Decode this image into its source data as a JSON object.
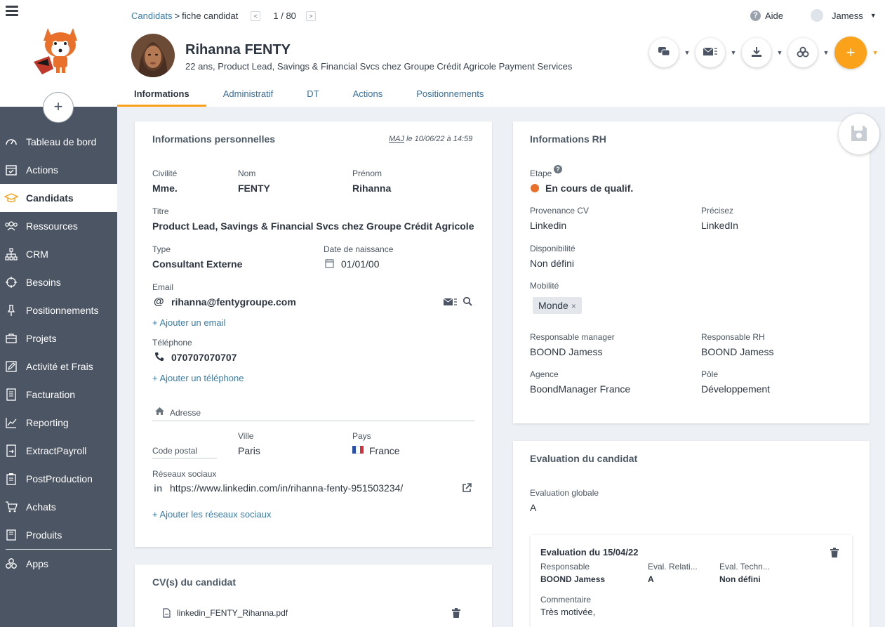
{
  "sidebar": {
    "items": [
      {
        "label": "Tableau de bord",
        "icon": "dashboard-icon"
      },
      {
        "label": "Actions",
        "icon": "calendar-check-icon"
      },
      {
        "label": "Candidats",
        "icon": "graduation-cap-icon",
        "active": true
      },
      {
        "label": "Ressources",
        "icon": "users-icon"
      },
      {
        "label": "CRM",
        "icon": "org-chart-icon"
      },
      {
        "label": "Besoins",
        "icon": "crosshair-icon"
      },
      {
        "label": "Positionnements",
        "icon": "pin-icon"
      },
      {
        "label": "Projets",
        "icon": "briefcase-icon"
      },
      {
        "label": "Activité et Frais",
        "icon": "edit-icon"
      },
      {
        "label": "Facturation",
        "icon": "invoice-icon"
      },
      {
        "label": "Reporting",
        "icon": "chart-line-icon"
      },
      {
        "label": "ExtractPayroll",
        "icon": "export-icon"
      },
      {
        "label": "PostProduction",
        "icon": "clipboard-icon"
      },
      {
        "label": "Achats",
        "icon": "cart-icon"
      },
      {
        "label": "Produits",
        "icon": "book-icon"
      },
      {
        "label": "Apps",
        "icon": "apps-icon"
      }
    ],
    "add_label": "+"
  },
  "header": {
    "breadcrumb_link": "Candidats",
    "breadcrumb_sep": ">",
    "breadcrumb_current": "fiche candidat",
    "pager_prev": "<",
    "pager_next": ">",
    "pager_count": "1 / 80",
    "help_label": "Aide",
    "user_name": "Jamess",
    "candidate_name": "Rihanna FENTY",
    "candidate_subtitle": "22 ans, Product Lead, Savings & Financial Svcs chez Groupe Crédit Agricole Payment Services",
    "add_label": "+"
  },
  "tabs": [
    {
      "label": "Informations",
      "active": true
    },
    {
      "label": "Administratif"
    },
    {
      "label": "DT"
    },
    {
      "label": "Actions"
    },
    {
      "label": "Positionnements"
    }
  ],
  "personal": {
    "title": "Informations personnelles",
    "maj_prefix": "MAJ",
    "maj_date": " le 10/06/22 à 14:59",
    "civilite_label": "Civilité",
    "civilite": "Mme.",
    "nom_label": "Nom",
    "nom": "FENTY",
    "prenom_label": "Prénom",
    "prenom": "Rihanna",
    "titre_label": "Titre",
    "titre": "Product Lead, Savings & Financial Svcs chez Groupe Crédit Agricole Paym",
    "type_label": "Type",
    "type": "Consultant Externe",
    "naissance_label": "Date de naissance",
    "naissance": "01/01/00",
    "email_label": "Email",
    "email": "rihanna@fentygroupe.com",
    "add_email": "+ Ajouter un email",
    "tel_label": "Téléphone",
    "tel": "070707070707",
    "add_tel": "+ Ajouter un téléphone",
    "adresse_label": "Adresse",
    "cp_label": "Code postal",
    "ville_label": "Ville",
    "ville": "Paris",
    "pays_label": "Pays",
    "pays": "France",
    "reseaux_label": "Réseaux sociaux",
    "linkedin": "https://www.linkedin.com/in/rihanna-fenty-951503234/",
    "add_reseaux": "+ Ajouter les réseaux sociaux"
  },
  "cv": {
    "title": "CV(s) du candidat",
    "file": "linkedin_FENTY_Rihanna.pdf"
  },
  "rh": {
    "title": "Informations RH",
    "etape_label": "Etape",
    "etape": "En cours de qualif.",
    "provenance_label": "Provenance CV",
    "provenance": "Linkedin",
    "precisez_label": "Précisez",
    "precisez": "LinkedIn",
    "dispo_label": "Disponibilité",
    "dispo": "Non défini",
    "mobilite_label": "Mobilité",
    "mobilite": "Monde",
    "manager_label": "Responsable manager",
    "manager": "BOOND Jamess",
    "resp_rh_label": "Responsable RH",
    "resp_rh": "BOOND Jamess",
    "agence_label": "Agence",
    "agence": "BoondManager France",
    "pole_label": "Pôle",
    "pole": "Développement",
    "status_color": "#e8702a"
  },
  "evaluation": {
    "title": "Evaluation du candidat",
    "globale_label": "Evaluation globale",
    "globale": "A",
    "item_title": "Evaluation du 15/04/22",
    "responsable_label": "Responsable",
    "responsable": "BOOND Jamess",
    "relati_label": "Eval. Relati...",
    "relati": "A",
    "techn_label": "Eval. Techn...",
    "techn": "Non défini",
    "commentaire_label": "Commentaire",
    "commentaire": "Très motivée,"
  },
  "colors": {
    "accent": "#f9a21a",
    "sidebar": "#4b5563",
    "link": "#3a7ca5"
  }
}
